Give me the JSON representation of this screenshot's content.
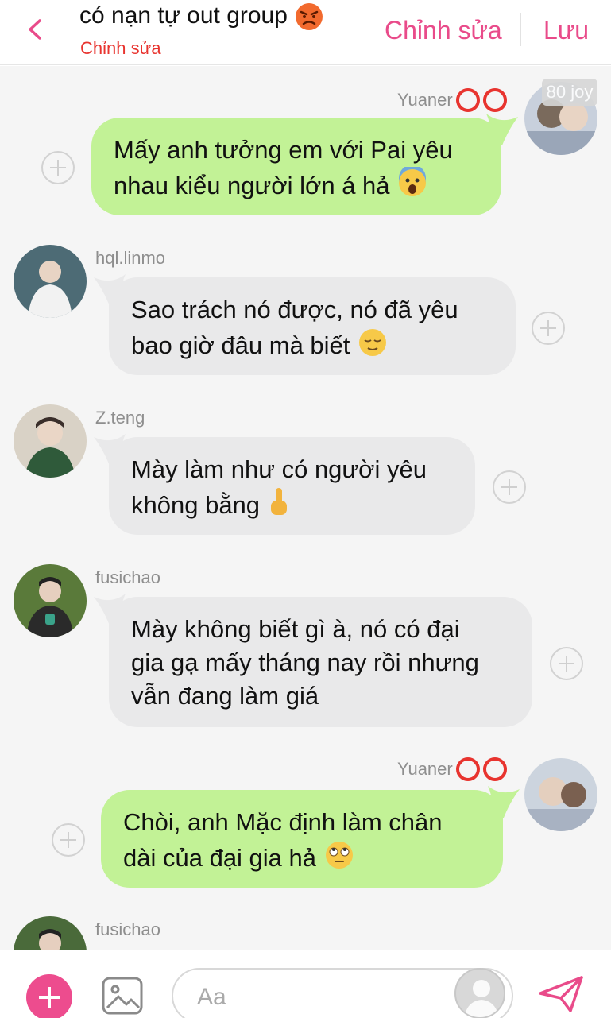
{
  "header": {
    "title": "có nạn tự out group",
    "title_emoji": "angry-face",
    "subtitle": "Chỉnh sửa",
    "edit_label": "Chỉnh sửa",
    "save_label": "Lưu"
  },
  "messages": [
    {
      "sender": "Yuaner",
      "side": "right",
      "text_line1": "Mấy anh tưởng em với Pai yêu",
      "text_line2": "nhau kiểu người lớn á hả",
      "emoji": "screaming-face",
      "overlay_tag": "80 joy"
    },
    {
      "sender": "hql.linmo",
      "side": "left",
      "text_line1": "Sao trách nó được, nó đã yêu",
      "text_line2": "bao giờ đâu mà biết",
      "emoji": "relieved-face"
    },
    {
      "sender": "Z.teng",
      "side": "left",
      "text_line1": "Mày làm như có người yêu",
      "text_line2": "không bằng",
      "emoji": "middle-finger"
    },
    {
      "sender": "fusichao",
      "side": "left",
      "text_line1": "Mày không biết gì à, nó có đại",
      "text_line2": "gia gạ mấy tháng nay rồi nhưng",
      "text_line3": "vẫn đang làm giá"
    },
    {
      "sender": "Yuaner",
      "side": "right",
      "text_line1": "Chòi, anh Mặc định làm chân",
      "text_line2": "dài của đại gia hả",
      "emoji": "rolling-eyes-face"
    },
    {
      "sender": "fusichao",
      "side": "left"
    }
  ],
  "composer": {
    "placeholder": "Aa"
  },
  "colors": {
    "accent": "#e94b8a",
    "subtitle_red": "#e8342f",
    "bubble_green": "#c2f296",
    "bubble_gray": "#e9e9ea"
  }
}
